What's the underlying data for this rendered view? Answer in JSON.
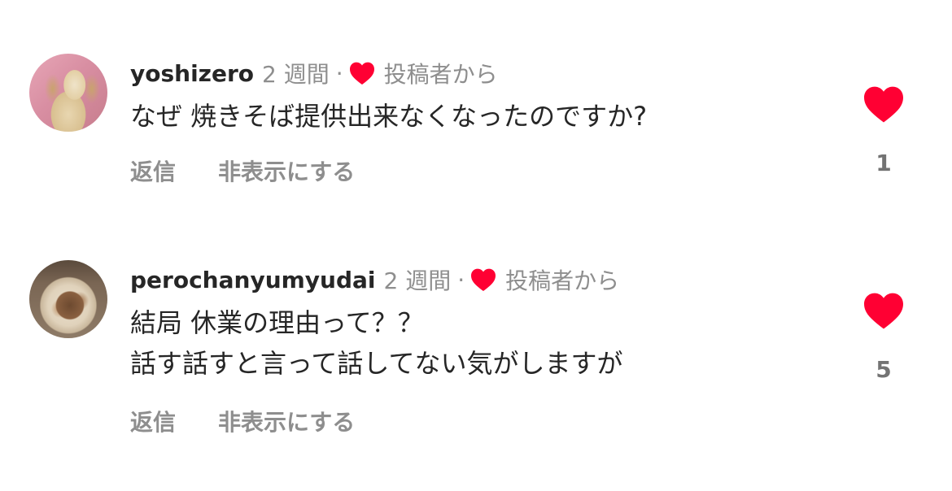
{
  "comments": [
    {
      "username": "yoshizero",
      "time": "2 週間",
      "separator": "·",
      "author_liked_label": "投稿者から",
      "lines": [
        "なぜ 焼きそば提供出来なくなったのですか?"
      ],
      "reply_label": "返信",
      "hide_label": "非表示にする",
      "like_count": "1",
      "avatar_icon": "avatar-dog-photo"
    },
    {
      "username": "perochanyumyudai",
      "time": "2 週間",
      "separator": "·",
      "author_liked_label": "投稿者から",
      "lines": [
        "結局 休業の理由って？？",
        "話す話すと言って話してない気がしますが"
      ],
      "reply_label": "返信",
      "hide_label": "非表示にする",
      "like_count": "5",
      "avatar_icon": "avatar-food-photo"
    }
  ],
  "colors": {
    "heart": "#ff0033",
    "secondary_text": "#8e8e8e",
    "primary_text": "#262626"
  }
}
